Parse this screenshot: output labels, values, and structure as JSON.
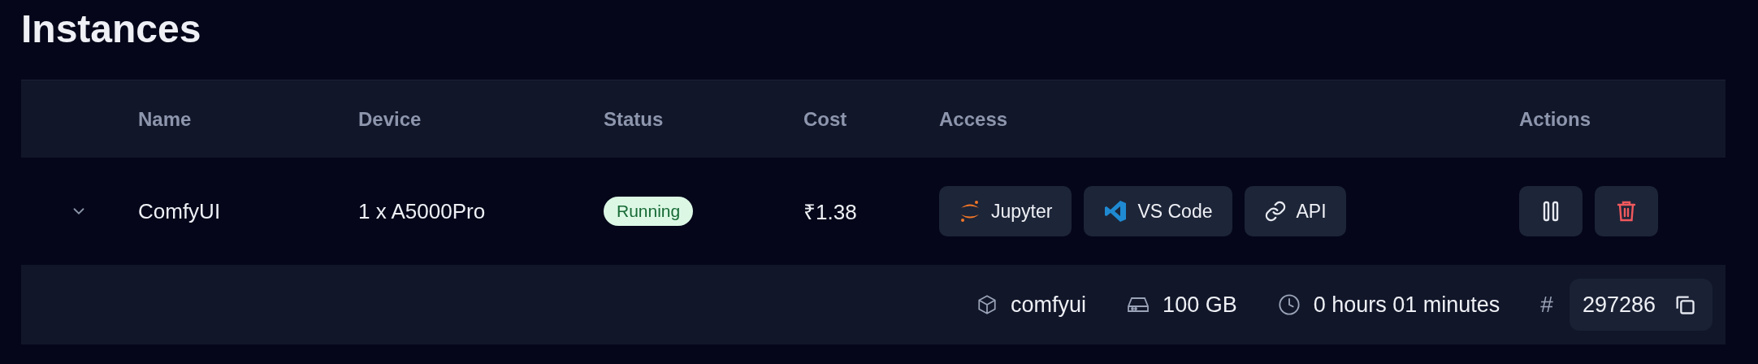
{
  "title": "Instances",
  "table": {
    "columns": [
      "Name",
      "Device",
      "Status",
      "Cost",
      "Access",
      "Actions"
    ],
    "rows": [
      {
        "expanded": true,
        "name": "ComfyUI",
        "device": "1 x A5000Pro",
        "status": {
          "label": "Running",
          "kind": "running"
        },
        "cost": "₹1.38",
        "access": [
          {
            "label": "Jupyter",
            "kind": "jupyter"
          },
          {
            "label": "VS Code",
            "kind": "vscode"
          },
          {
            "label": "API",
            "kind": "link"
          }
        ],
        "actions": [
          {
            "kind": "pause"
          },
          {
            "kind": "delete"
          }
        ],
        "details": {
          "image": "comfyui",
          "storage": "100 GB",
          "uptime": "0 hours 01 minutes",
          "hash": "#",
          "id": "297286"
        }
      }
    ]
  }
}
